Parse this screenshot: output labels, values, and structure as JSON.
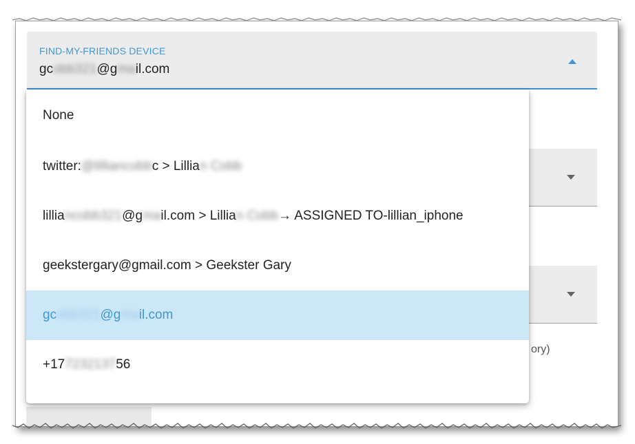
{
  "select": {
    "label": "FIND-MY-FRIENDS DEVICE",
    "value_prefix": "gc",
    "value_hidden_1": "obb321",
    "value_at": "@g",
    "value_hidden_2": "ma",
    "value_suffix": "il.com"
  },
  "options": [
    {
      "parts": [
        "None"
      ]
    },
    {
      "prefix": "twitter:",
      "hidden1": "@lilliancobb",
      "mid": "c > Lillia",
      "hidden2": "n Cobb",
      "suffix": ""
    },
    {
      "prefix": "lillia",
      "hidden1": "ncobb321",
      "mid": "@g",
      "hidden2": "ma",
      "mid2": "il.com > Lillia",
      "hidden3": "n Cobb",
      "suffix": " → ASSIGNED TO-lillian_iphone"
    },
    {
      "parts": [
        "geekstergary@gmail.com > Geekster Gary"
      ]
    },
    {
      "prefix": "gc",
      "hidden1": "obb321",
      "mid": "@g",
      "hidden2": "ma",
      "suffix": "il.com"
    },
    {
      "prefix": "+17",
      "hidden1": "7232137",
      "suffix": "56"
    }
  ],
  "background": {
    "partial_text": "ory)"
  },
  "colors": {
    "accent": "#3f97d8",
    "selected_bg": "#cce7f7",
    "field_bg": "#ececec"
  }
}
